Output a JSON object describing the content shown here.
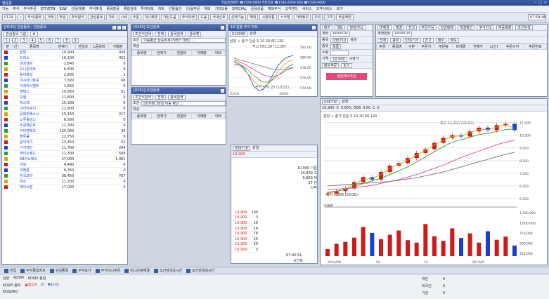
{
  "app": {
    "title": "영웅문",
    "header_info": "키움증권센터 ☎1544-0000 주문전용 ☎1544-4369 ARS ☎1544-9000"
  },
  "menu": [
    "기능",
    "주식",
    "주식주문",
    "ETF/ETN",
    "ELW",
    "신용/대출",
    "주식파생",
    "종목발굴",
    "종합검색",
    "투자정보",
    "차트",
    "선물옵션",
    "선/옵주문",
    "해외",
    "기타도움",
    "SPECIAL",
    "금융상품",
    "해외주식",
    "고객센터",
    "서비스",
    "고객서비스",
    "보기"
  ],
  "toolbar": {
    "code_input": "0114",
    "buttons": [
      "주식/종목",
      "거래",
      "주문",
      "주식분석",
      "관심종목",
      "차트",
      "시세",
      "주문",
      "미니화면",
      "대신도움",
      "주식파생",
      "도움",
      "국내신호",
      "선택기능",
      "해외",
      "시장흐름",
      "스크랩",
      "거래정보",
      "조회",
      "고객",
      "주문화면"
    ],
    "clock": "07:59:46"
  },
  "watchlist": {
    "title": "[0130] 관심종목 - 관심종목",
    "group": "관심종목 그룹",
    "tabs": [
      "1",
      "2",
      "3",
      "4",
      "5",
      "6",
      "7",
      "8",
      "9"
    ],
    "columns": [
      "분",
      "선",
      "종목명",
      "현재가",
      "전일비",
      "L등락비",
      "거래량"
    ],
    "rows": [
      {
        "name": "삼양",
        "price": "10,900",
        "chg": "",
        "rate": "",
        "vol": "938"
      },
      {
        "name": "드라소",
        "price": "19,100",
        "chg": "",
        "rate": "",
        "vol": "452"
      },
      {
        "name": "미성엠피",
        "price": "1,645",
        "chg": "",
        "rate": "",
        "vol": "0"
      },
      {
        "name": "유니온머트",
        "price": "6,600",
        "chg": "",
        "rate": "",
        "vol": "0"
      },
      {
        "name": "동아화성",
        "price": "2,805",
        "chg": "",
        "rate": "",
        "vol": "1"
      },
      {
        "name": "아시아나항공",
        "price": "7,820",
        "chg": "",
        "rate": "",
        "vol": "68"
      },
      {
        "name": "아세아시멘트",
        "price": "1,655",
        "chg": "",
        "rate": "",
        "vol": "0"
      },
      {
        "name": "엠텍스",
        "price": "10,950",
        "chg": "",
        "rate": "",
        "vol": "51"
      },
      {
        "name": "모셈",
        "price": "11,600",
        "chg": "",
        "rate": "",
        "vol": "0"
      },
      {
        "name": "마스텍",
        "price": "10,300",
        "chg": "",
        "rate": "",
        "vol": "0"
      },
      {
        "name": "코리아써키",
        "price": "12,800",
        "chg": "",
        "rate": "",
        "vol": "0"
      },
      {
        "name": "금화피에스시",
        "price": "15,150",
        "chg": "",
        "rate": "",
        "vol": "217"
      },
      {
        "name": "노루홀딩스",
        "price": "6,930",
        "chg": "",
        "rate": "",
        "vol": "0"
      },
      {
        "name": "조광페인트",
        "price": "11,300",
        "chg": "",
        "rate": "",
        "vol": "0"
      },
      {
        "name": "아이엠텍코",
        "price": "125,000",
        "chg": "",
        "rate": "",
        "vol": "35"
      },
      {
        "name": "블루콤",
        "price": "12,750",
        "chg": "",
        "rate": "",
        "vol": "0"
      },
      {
        "name": "삼익악기",
        "price": "13,450",
        "chg": "",
        "rate": "",
        "vol": "52"
      },
      {
        "name": "기가레인",
        "price": "11,700",
        "chg": "",
        "rate": "",
        "vol": "204"
      },
      {
        "name": "바이오랜드",
        "price": "11,300",
        "chg": "",
        "rate": "",
        "vol": "509"
      },
      {
        "name": "KB이노텍스",
        "price": "27,000",
        "chg": "",
        "rate": "",
        "vol": "1,461"
      },
      {
        "name": "이밀",
        "price": "4,490",
        "chg": "",
        "rate": "",
        "vol": "0"
      },
      {
        "name": "코메론",
        "price": "9,350",
        "chg": "",
        "rate": "",
        "vol": "0"
      },
      {
        "name": "한국코아",
        "price": "38,450",
        "chg": "",
        "rate": "",
        "vol": "767"
      },
      {
        "name": "태소",
        "price": "11,200",
        "chg": "",
        "rate": "",
        "vol": "0"
      },
      {
        "name": "제이씨현",
        "price": "17,000",
        "chg": "",
        "rate": "",
        "vol": "0"
      }
    ]
  },
  "search_panel": {
    "title": "[0150] 조건검색",
    "tabs": [
      "조건식검색",
      "전체",
      "종목검색",
      "종목명"
    ],
    "condition_label": "조건",
    "condition_text": "이동평균 상승추세(거래가 대비) ...",
    "target_label": "대상",
    "columns": [
      "종목명",
      "현재가",
      "전일비",
      "거래량",
      "대비"
    ]
  },
  "search_panel2": {
    "title": "[0151] 조건검색",
    "tabs": [
      "조건식검색",
      "전체",
      "종목검색"
    ],
    "condition_label": "조건",
    "condition_text": "[0]지정 20일 이동 평균 ...",
    "target_label": "대상",
    "columns": [
      "종목명",
      "현재가",
      "전일비",
      "거래량",
      "대비"
    ]
  },
  "mini_chart": {
    "title": "10 일봉 주식 차트",
    "code": "010000",
    "name": "삼양",
    "legend": "삼양 + 종가 단순 5 10 20 60 120",
    "high_label": "최고 582.29 (11/26)",
    "low_label": "최저 576.25 (10/21)",
    "y_ticks": [
      "582.00",
      "580.00",
      "578.00",
      "576.00",
      "574.00"
    ],
    "x_ticks": [
      "01/18",
      "10/26"
    ]
  },
  "order_panel": {
    "tabs": [
      "매수",
      "매도",
      "정정/취소"
    ],
    "account_label": "계좌",
    "account_value": "******-**",
    "code_label": "종목",
    "code_value": "036710",
    "name_value": "삼양",
    "type_label": "종류",
    "type_value": "보통",
    "qty_label": "수량",
    "qty_value": "",
    "price_label": "가격",
    "price_value": "10,900",
    "market_label": "시장가",
    "order_btn": "매수주문",
    "cancel_btn": "초기",
    "submit_btn": "현금매수주문"
  },
  "order_book": {
    "code": "036710",
    "name": "삼양",
    "price": "10,900",
    "rows": [
      {
        "ask_vol": "",
        "price": "",
        "bid_vol": ""
      },
      {
        "ask_vol": "",
        "price": "",
        "bid_vol": ""
      }
    ],
    "summary_lines": [
      "10,900 기준",
      "10,900 고",
      "9,900 저",
      "27 건",
      "시작"
    ],
    "bottom_rows": [
      {
        "price": "10,900",
        "vol": "100"
      },
      {
        "price": "10,900",
        "vol": "3"
      },
      {
        "price": "10,900",
        "vol": "10"
      },
      {
        "price": "10,900",
        "vol": "14"
      },
      {
        "price": "10,900",
        "vol": "76"
      },
      {
        "price": "10,900",
        "vol": "20"
      },
      {
        "price": "10,900",
        "vol": "50"
      },
      {
        "price": "10,900",
        "vol": "3"
      }
    ],
    "time": "07:45:51",
    "status": "시간외"
  },
  "account_panel": {
    "tabs": [
      "미체결",
      "체결",
      "잔고",
      "주문가능",
      "당일매매",
      "체결확인",
      "주식잔고",
      "자동매매",
      "조건검색"
    ],
    "account_label": "계좌번호",
    "account_value": "******-**",
    "filters": [
      "전체",
      "종목",
      "036710",
      "잔고",
      "매수",
      "매도"
    ],
    "columns": [
      "주문",
      "종목명",
      "구분",
      "주문가",
      "주문량",
      "미체결",
      "현재가",
      "L(신)",
      "주문시각",
      "주문번호"
    ]
  },
  "big_chart": {
    "code": "036710",
    "name": "삼양",
    "info_bar": [
      "10,900",
      "0",
      "0.00%",
      "508",
      "0.00",
      "1",
      "0"
    ],
    "legend": "삼양 + 종가 단순 5 10 20 60 120",
    "high_label": "최고 11,450 (01/06)",
    "low_label": "최저 5,880 (03/30)",
    "y_ticks": [
      "11,500",
      "10,500",
      "9,500",
      "8,500",
      "7,500",
      "6,500",
      "5,500"
    ],
    "vol_ticks": [
      "1,250,000",
      "1,000,000",
      "750,000",
      "500,000",
      "250,000"
    ],
    "x_ticks": [
      "2014/08",
      "10",
      "12",
      "2015/01"
    ],
    "volume_label": "거래량"
  },
  "chart_data": {
    "type": "line",
    "title": "삼양",
    "series": [
      {
        "name": "종가",
        "values": [
          5900,
          6100,
          6300,
          6800,
          7200,
          7000,
          7600,
          8100,
          8300,
          8700,
          9100,
          9400,
          9900,
          10300,
          10500,
          10400,
          10800,
          11100,
          10900,
          11300,
          11400,
          10900
        ]
      },
      {
        "name": "5",
        "values": [
          5950,
          6050,
          6250,
          6650,
          7000,
          7100,
          7400,
          7900,
          8200,
          8550,
          8950,
          9300,
          9750,
          10100,
          10400,
          10450,
          10700,
          10950,
          10950,
          11150,
          11300,
          11050
        ]
      },
      {
        "name": "20",
        "values": [
          6000,
          6100,
          6200,
          6450,
          6700,
          6900,
          7100,
          7400,
          7700,
          8000,
          8400,
          8800,
          9200,
          9600,
          9950,
          10150,
          10350,
          10550,
          10650,
          10800,
          10950,
          11000
        ]
      },
      {
        "name": "60",
        "values": [
          6200,
          6250,
          6300,
          6350,
          6450,
          6550,
          6700,
          6850,
          7000,
          7200,
          7400,
          7650,
          7900,
          8150,
          8450,
          8750,
          9000,
          9250,
          9500,
          9750,
          9950,
          10100
        ]
      },
      {
        "name": "120",
        "values": [
          6500,
          6550,
          6600,
          6650,
          6700,
          6750,
          6800,
          6850,
          6950,
          7050,
          7150,
          7300,
          7450,
          7600,
          7800,
          8000,
          8200,
          8400,
          8600,
          8800,
          9000,
          9150
        ]
      }
    ],
    "volume": [
      200000,
      350000,
      400000,
      520000,
      820000,
      650000,
      480000,
      600000,
      720000,
      450000,
      380000,
      900000,
      560000,
      430000,
      780000,
      510000,
      640000,
      380000,
      700000,
      460000,
      550000,
      300000
    ],
    "ylim": [
      5500,
      11700
    ]
  },
  "taskbar": {
    "items": [
      "전업",
      "주식종합차트",
      "관심종목",
      "주식호가",
      "주식미니주문",
      "미니잔량체결",
      "조건검색실시간",
      "조건검색실시간"
    ]
  },
  "status_bar": {
    "left_label": "삼양",
    "kospi_label": "KOSPI",
    "kospi_value": "KOSPI 종합",
    "kosdaq_label": "KOSDAQ",
    "indicators": [
      "KOSPI 등락",
      "▲0(10)",
      "0",
      "▼1(-0)"
    ],
    "right_labels": [
      "개인",
      "외국인",
      "기관"
    ],
    "right_values": [
      "0",
      "0",
      "0"
    ]
  },
  "colors": {
    "up": "#d01a1a",
    "down": "#1a3fd0",
    "ma5": "#e0a000",
    "ma20": "#30a030",
    "ma60": "#e040a0",
    "ma120": "#707070"
  }
}
